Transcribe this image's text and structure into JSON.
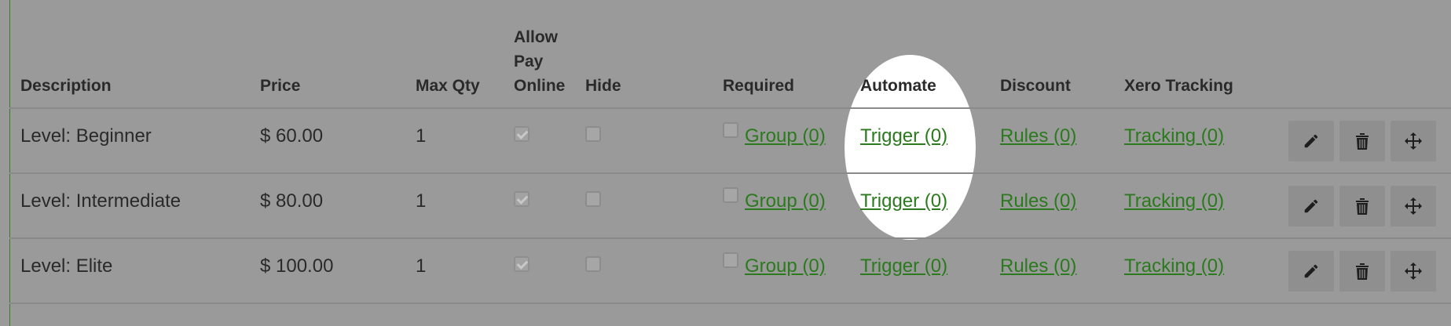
{
  "columns": {
    "description": "Description",
    "price": "Price",
    "max_qty": "Max Qty",
    "allow_pay_online": "Allow Pay Online",
    "hide": "Hide",
    "required": "Required",
    "automate": "Automate",
    "discount": "Discount",
    "xero_tracking": "Xero Tracking"
  },
  "rows": [
    {
      "description": "Level: Beginner",
      "price": "$ 60.00",
      "max_qty": "1",
      "allow_pay_online": true,
      "hide": false,
      "required": false,
      "group_link": "Group (0)",
      "trigger_link": "Trigger (0)",
      "rules_link": "Rules (0)",
      "tracking_link": "Tracking (0)"
    },
    {
      "description": "Level: Intermediate",
      "price": "$ 80.00",
      "max_qty": "1",
      "allow_pay_online": true,
      "hide": false,
      "required": false,
      "group_link": "Group (0)",
      "trigger_link": "Trigger (0)",
      "rules_link": "Rules (0)",
      "tracking_link": "Tracking (0)"
    },
    {
      "description": "Level: Elite",
      "price": "$ 100.00",
      "max_qty": "1",
      "allow_pay_online": true,
      "hide": false,
      "required": false,
      "group_link": "Group (0)",
      "trigger_link": "Trigger (0)",
      "rules_link": "Rules (0)",
      "tracking_link": "Tracking (0)"
    }
  ],
  "icons": {
    "edit": "pencil-icon",
    "delete": "trash-icon",
    "move": "move-arrows-icon"
  },
  "colors": {
    "link": "#2b7a1e",
    "overlay_background": "#9a9a9a",
    "highlight": "#ffffff",
    "action_button": "#8f8f8f"
  }
}
